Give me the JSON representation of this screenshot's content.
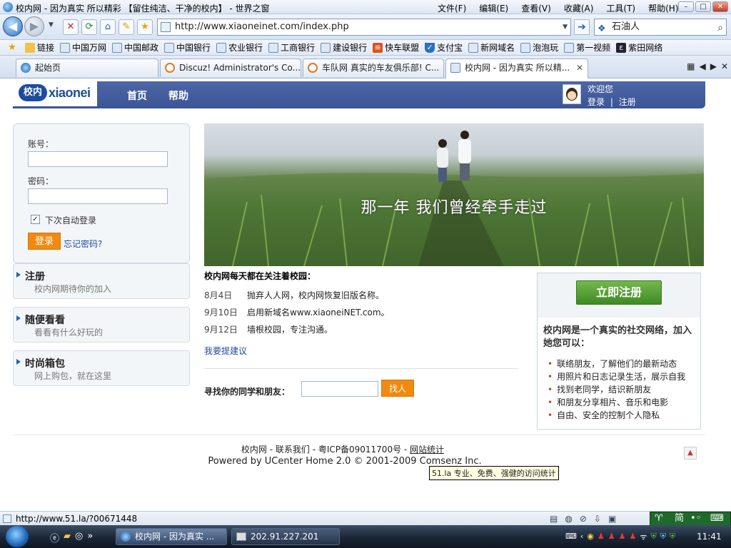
{
  "browser": {
    "window_title": "校内网 - 因为真实 所以精彩 【留住纯洁、干净的校内】 - 世界之窗",
    "menu": [
      "文件(F)",
      "编辑(E)",
      "查看(V)",
      "收藏(A)",
      "工具(T)",
      "帮助(H)"
    ],
    "address": "http://www.xiaoneinet.com/index.php",
    "search_value": "石油人",
    "favorites": [
      "链接",
      "中国万网",
      "中国邮政",
      "中国银行",
      "农业银行",
      "工商银行",
      "建设银行",
      "快车联盟",
      "支付宝",
      "新网域名",
      "泡泡玩",
      "第一视频",
      "紫田网络"
    ],
    "tabs": [
      {
        "label": "起始页"
      },
      {
        "label": "Discuz! Administrator's Co..."
      },
      {
        "label": "车队网 真实的车友俱乐部! C..."
      },
      {
        "label": "校内网 - 因为真实 所以精..."
      }
    ],
    "status_text": "http://www.51.la/?00671448",
    "ime_label": "简"
  },
  "site": {
    "logo_badge": "校内",
    "logo_word": "xiaonei",
    "nav": [
      "首页",
      "帮助"
    ],
    "welcome": "欢迎您",
    "login_link": "登录",
    "sep": "|",
    "register_link": "注册"
  },
  "login": {
    "account_label": "账号：",
    "password_label": "密码：",
    "remember_label": "下次自动登录",
    "login_button": "登录",
    "forgot_link": "忘记密码?"
  },
  "side_links": [
    {
      "title": "注册",
      "subtitle": "校内网期待你的加入"
    },
    {
      "title": "随便看看",
      "subtitle": "看看有什么好玩的"
    },
    {
      "title": "时尚箱包",
      "subtitle": "网上购包，就在这里"
    }
  ],
  "banner_caption": "那一年 我们曾经牵手走过",
  "news": {
    "heading": "校内网每天都在关注着校园：",
    "items": [
      {
        "date": "8月4日",
        "text": "抛弃人人网，校内网恢复旧版名称。"
      },
      {
        "date": "9月10日",
        "text": "启用新域名www.xiaoneiNET.com。"
      },
      {
        "date": "9月12日",
        "text": "墙根校园，专注沟通。"
      }
    ],
    "suggest_link": "我要提建议"
  },
  "find": {
    "label": "寻找你的同学和朋友：",
    "button": "找人"
  },
  "register_box": {
    "button": "立即注册",
    "desc": "校内网是一个真实的社交网络，加入她您可以：",
    "features": [
      "联络朋友，了解他们的最新动态",
      "用照片和日志记录生活，展示自我",
      "找到老同学，结识新朋友",
      "和朋友分享相片、音乐和电影",
      "自由、安全的控制个人隐私"
    ]
  },
  "footer": {
    "links": "校内网 - 联系我们 - 粤ICP备09011700号 - ",
    "stats_link": "网站统计",
    "powered": "Powered by UCenter Home 2.0 © 2001-2009 Comsenz Inc.",
    "tooltip": "51.la 专业、免费、强健的访问统计"
  },
  "taskbar": {
    "tasks": [
      "校内网 - 因为真实 ...",
      "202.91.227.201"
    ],
    "clock": "11:41"
  },
  "colors": {
    "site_blue": "#3b5596",
    "orange_button": "#f08a10",
    "green_button": "#4f9a31"
  }
}
